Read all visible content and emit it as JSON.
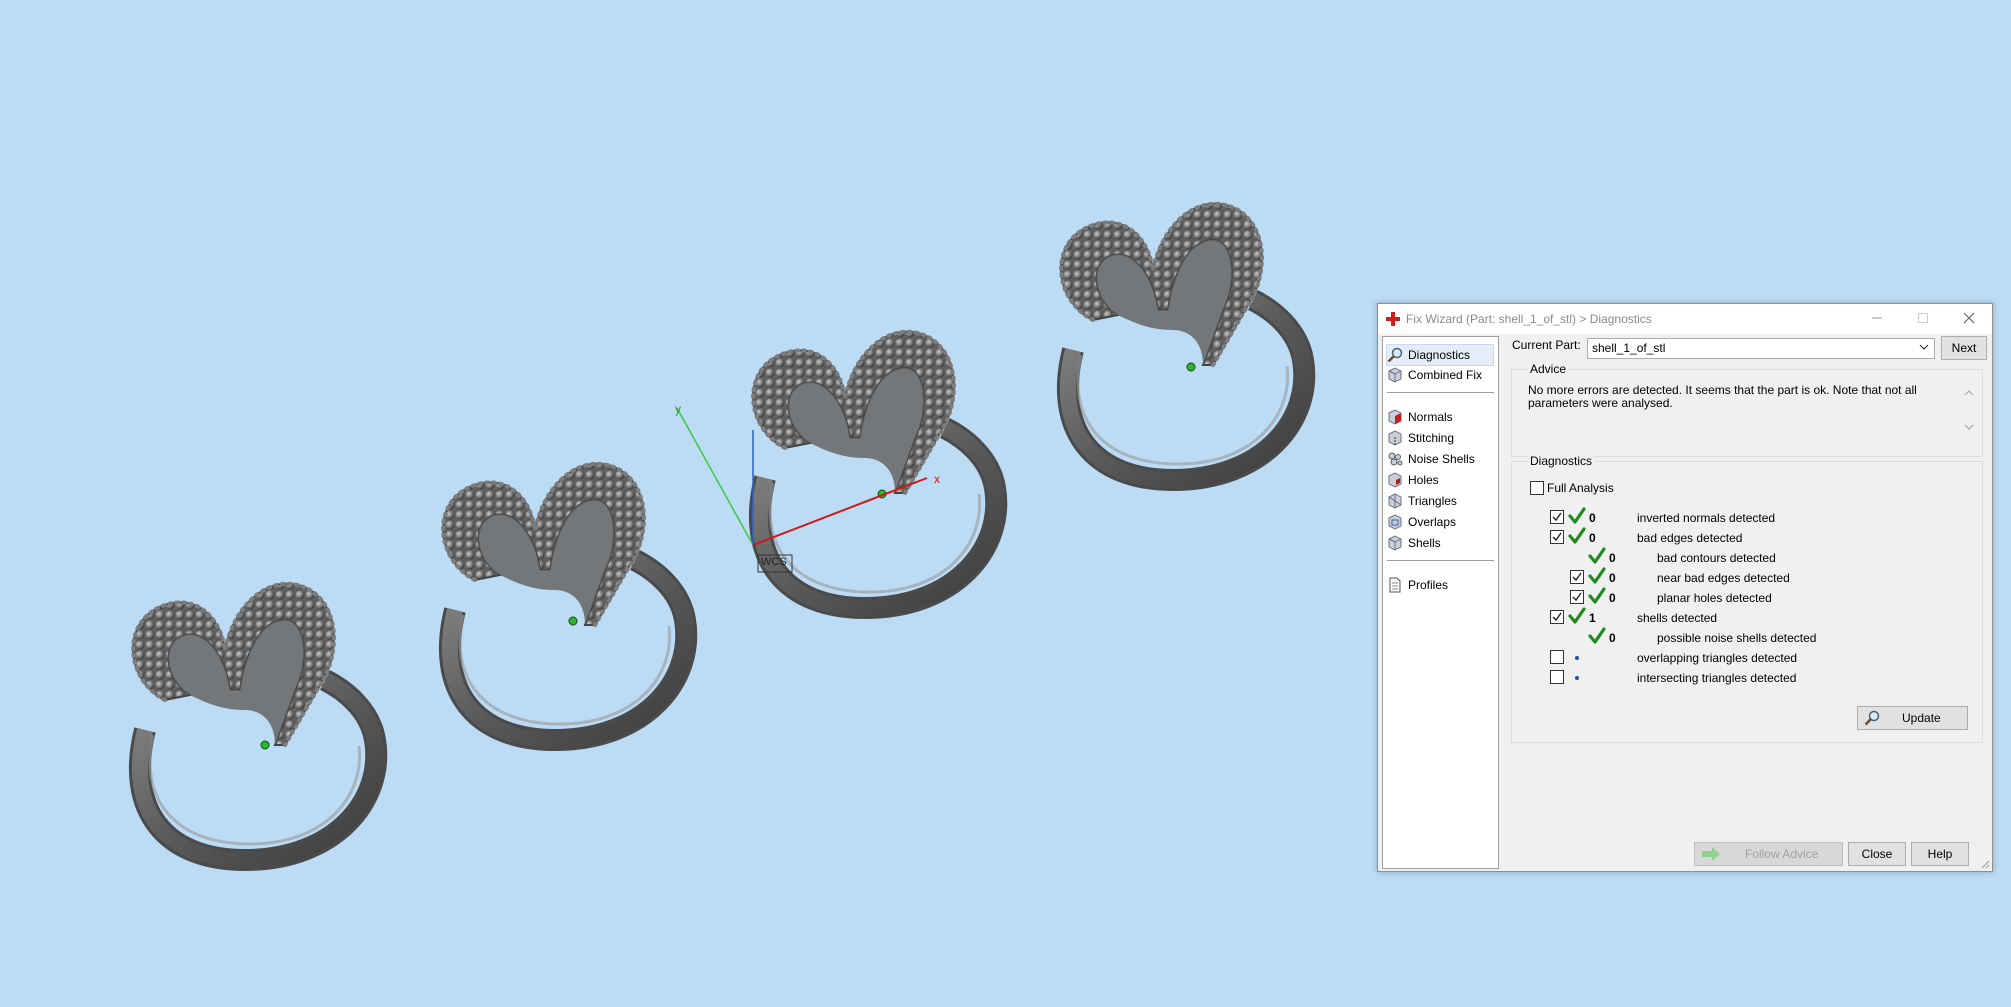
{
  "window": {
    "title": "Fix Wizard (Part: shell_1_of_stl) > Diagnostics",
    "minimize_icon": "minimize-icon",
    "maximize_icon": "maximize-icon",
    "close_icon": "close-icon"
  },
  "sidebar": {
    "items": [
      {
        "label": "Diagnostics",
        "icon": "magnifier-icon"
      },
      {
        "label": "Combined Fix",
        "icon": "cube-icon"
      },
      {
        "label": "Normals",
        "icon": "normals-cube-icon"
      },
      {
        "label": "Stitching",
        "icon": "stitching-cube-icon"
      },
      {
        "label": "Noise Shells",
        "icon": "noise-shells-icon"
      },
      {
        "label": "Holes",
        "icon": "holes-cube-icon"
      },
      {
        "label": "Triangles",
        "icon": "triangles-cube-icon"
      },
      {
        "label": "Overlaps",
        "icon": "overlaps-cube-icon"
      },
      {
        "label": "Shells",
        "icon": "shells-cube-icon"
      },
      {
        "label": "Profiles",
        "icon": "document-icon"
      }
    ],
    "selected": "Diagnostics"
  },
  "part": {
    "label": "Current Part:",
    "value": "shell_1_of_stl",
    "next_button": "Next"
  },
  "advice": {
    "heading": "Advice",
    "text": "No more errors are detected. It seems that the part is ok. Note that not all parameters were analysed."
  },
  "diagnostics": {
    "heading": "Diagnostics",
    "full_analysis_label": "Full Analysis",
    "rows": [
      {
        "checkbox": true,
        "status": "ok",
        "count": "0",
        "label": "inverted normals detected",
        "indent": 0
      },
      {
        "checkbox": true,
        "status": "ok",
        "count": "0",
        "label": "bad edges detected",
        "indent": 0
      },
      {
        "checkbox": null,
        "status": "ok",
        "count": "0",
        "label": "bad contours detected",
        "indent": 1
      },
      {
        "checkbox": true,
        "status": "ok",
        "count": "0",
        "label": "near bad edges detected",
        "indent": 1
      },
      {
        "checkbox": true,
        "status": "ok",
        "count": "0",
        "label": "planar holes detected",
        "indent": 1
      },
      {
        "checkbox": true,
        "status": "ok",
        "count": "1",
        "label": "shells detected",
        "indent": 0
      },
      {
        "checkbox": null,
        "status": "ok",
        "count": "0",
        "label": "possible noise shells detected",
        "indent": 1
      },
      {
        "checkbox": false,
        "status": "unknown",
        "count": "",
        "label": "overlapping triangles detected",
        "indent": 0
      },
      {
        "checkbox": false,
        "status": "unknown",
        "count": "",
        "label": "intersecting triangles detected",
        "indent": 0
      }
    ],
    "update_button": "Update"
  },
  "footer": {
    "follow_advice_button": "Follow Advice",
    "close_button": "Close",
    "help_button": "Help"
  },
  "viewport": {
    "axis_x_label": "x",
    "axis_y_label": "y",
    "origin_label": "WCS",
    "background_color": "#bcdcf6",
    "model_color": "#6b6b6b"
  }
}
